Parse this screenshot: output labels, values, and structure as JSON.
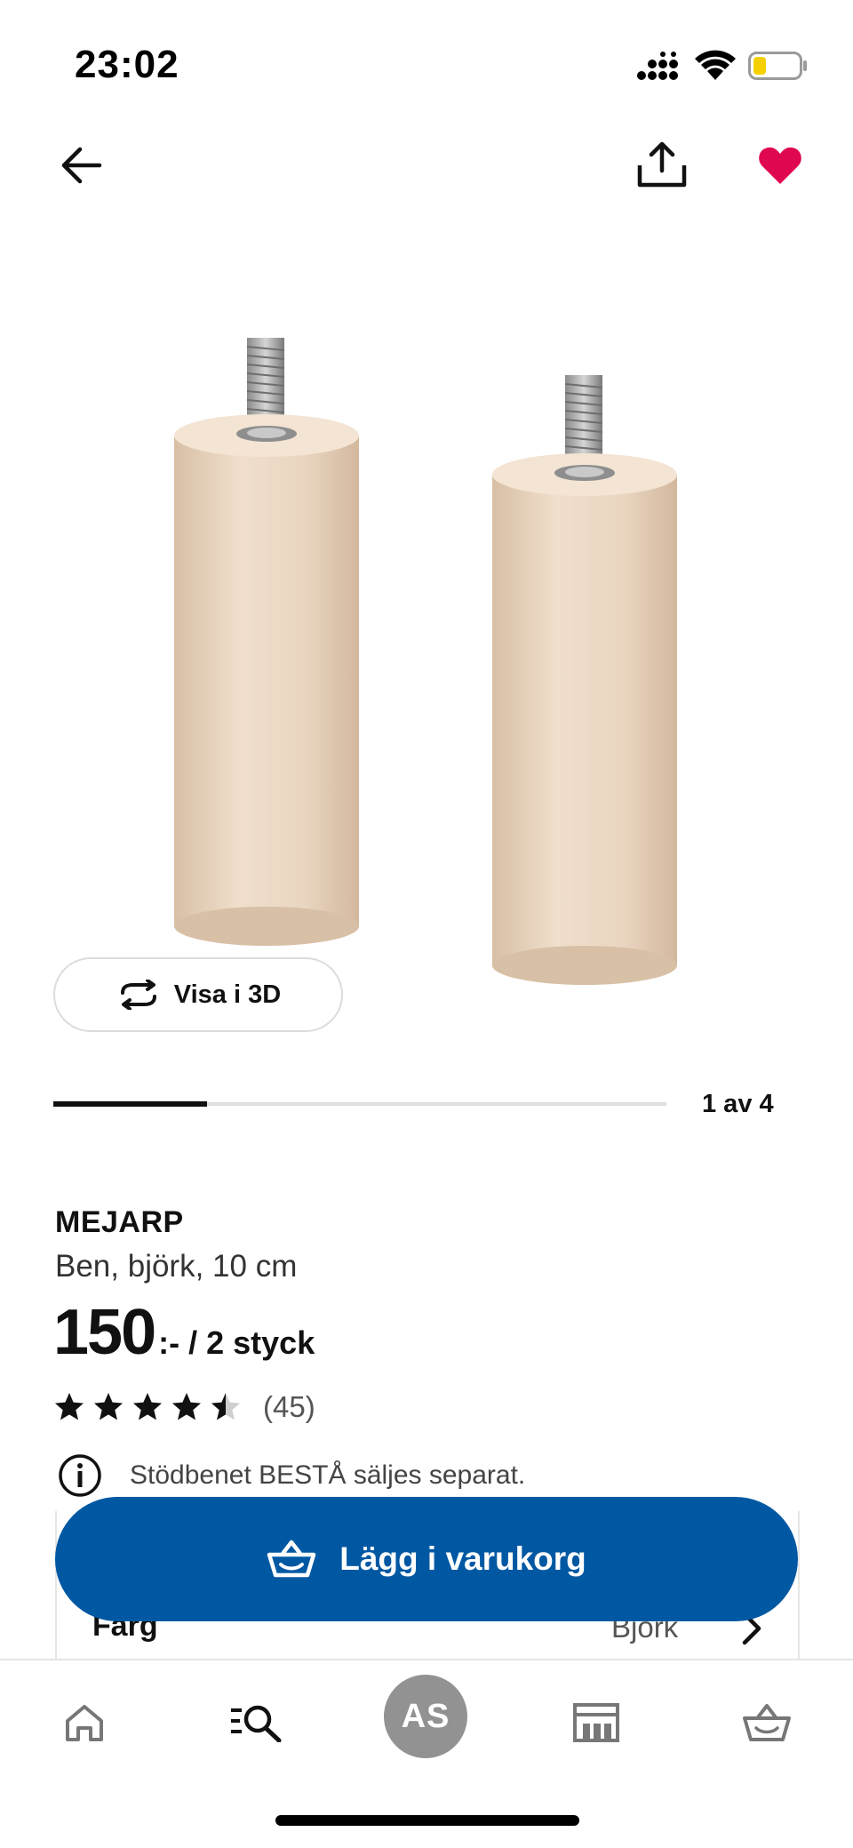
{
  "status": {
    "time": "23:02",
    "battery_color": "#f5d000"
  },
  "nav": {
    "back_icon": "arrow-left-icon",
    "share_icon": "share-icon",
    "favorite_icon": "heart-icon",
    "favorite_color": "#e00751"
  },
  "gallery": {
    "view3d_label": "Visa i 3D",
    "position_text": "1 av 4",
    "current": 1,
    "total": 4,
    "progress_fraction": 0.25
  },
  "product": {
    "name": "MEJARP",
    "description": "Ben, björk, 10 cm",
    "price_amount": "150",
    "price_suffix": ":- / 2 styck",
    "rating": 4.5,
    "rating_count": "(45)",
    "info_text": "Stödbenet BESTÅ säljes separat.",
    "color_label": "Färg",
    "color_value": "Björk"
  },
  "cart_button": {
    "label": "Lägg i varukorg",
    "color": "#0058a3"
  },
  "tabbar": {
    "profile_initials": "AS",
    "items": [
      "home-icon",
      "search-icon",
      "profile-avatar",
      "stores-icon",
      "cart-icon"
    ]
  }
}
